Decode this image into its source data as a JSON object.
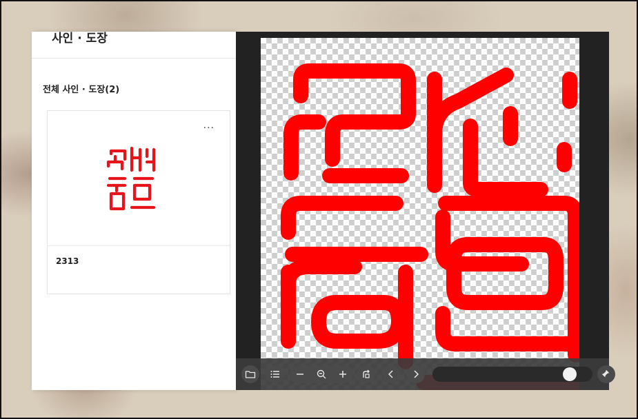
{
  "panel": {
    "title": "사인 · 도장",
    "section_title": "전체 사인 · 도장(2)"
  },
  "cards": [
    {
      "name": "2313",
      "more_label": "···",
      "thumbnail_color": "#e8141c"
    }
  ],
  "viewer": {
    "seal_color": "#ff0000",
    "background": "transparent-checkerboard",
    "toolbar": {
      "buttons": [
        "folder-icon",
        "list-icon",
        "zoom-out-icon",
        "zoom-icon",
        "zoom-in-icon",
        "rotate-icon",
        "prev-icon",
        "next-icon",
        "pin-icon"
      ],
      "slider_value": 0.9
    }
  }
}
